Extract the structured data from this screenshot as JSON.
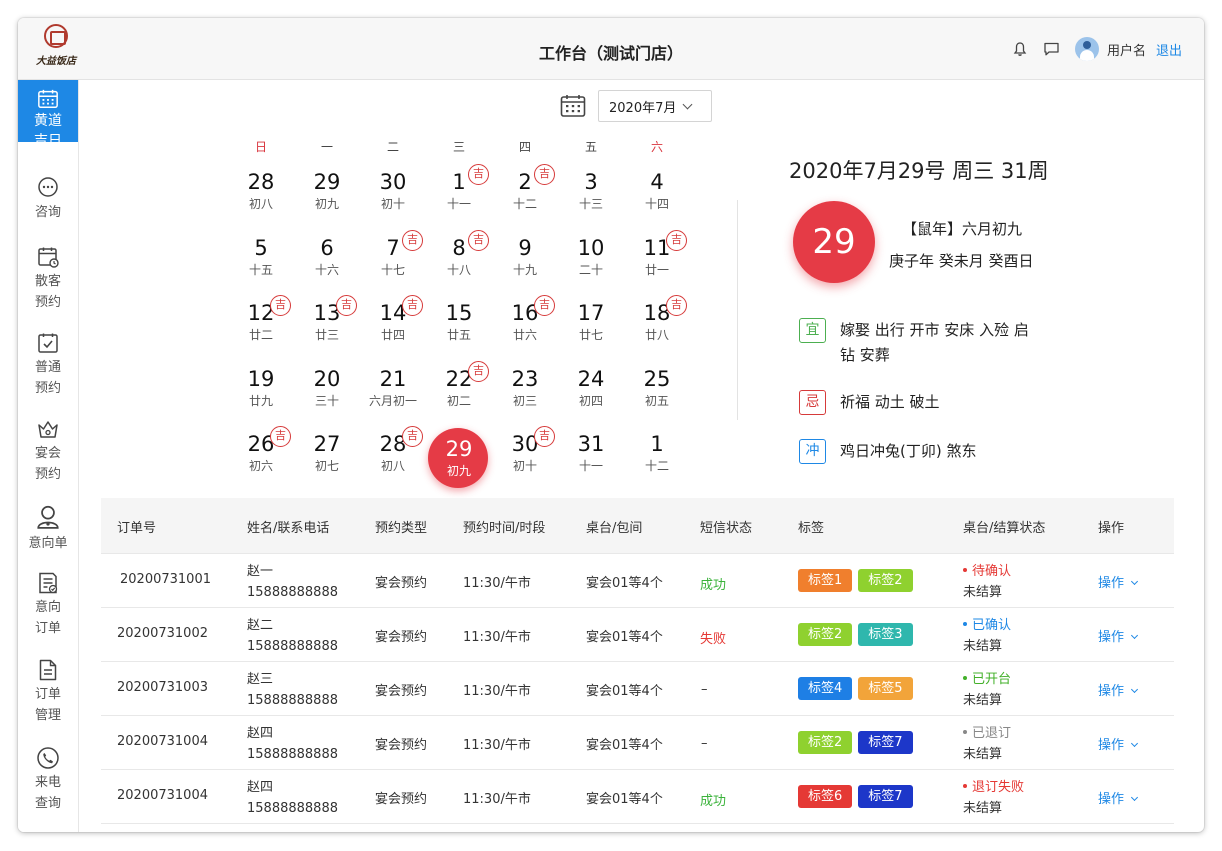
{
  "header": {
    "title": "工作台（测试门店）",
    "brand": "大益饭店",
    "username": "用户名",
    "logout": "退出",
    "icons": [
      "bell-icon",
      "message-icon",
      "avatar"
    ]
  },
  "sidebar": {
    "items": [
      {
        "label": "黄道吉日",
        "icon": "calendar-icon",
        "active": true
      },
      {
        "label": "咨询",
        "icon": "chat-bubble-icon"
      },
      {
        "label": "散客预约",
        "icon": "calendar-clock-icon"
      },
      {
        "label": "普通预约",
        "icon": "calendar-check-icon"
      },
      {
        "label": "宴会预约",
        "icon": "crown-basket-icon"
      },
      {
        "label": "意向单",
        "icon": "user-icon"
      },
      {
        "label": "意向订单",
        "icon": "document-check-icon"
      },
      {
        "label": "订单管理",
        "icon": "document-icon"
      },
      {
        "label": "来电查询",
        "icon": "phone-icon"
      }
    ]
  },
  "date_picker": {
    "value": "2020年7月"
  },
  "calendar": {
    "weekdays": [
      "日",
      "一",
      "二",
      "三",
      "四",
      "五",
      "六"
    ],
    "weekend_color": "#d9363e",
    "auspicious_mark": "吉",
    "selected_color": "#e53b46",
    "rows": [
      [
        {
          "d": "28",
          "l": "初八"
        },
        {
          "d": "29",
          "l": "初九"
        },
        {
          "d": "30",
          "l": "初十"
        },
        {
          "d": "1",
          "l": "十一",
          "ji": true
        },
        {
          "d": "2",
          "l": "十二",
          "ji": true
        },
        {
          "d": "3",
          "l": "十三"
        },
        {
          "d": "4",
          "l": "十四"
        }
      ],
      [
        {
          "d": "5",
          "l": "十五"
        },
        {
          "d": "6",
          "l": "十六"
        },
        {
          "d": "7",
          "l": "十七",
          "ji": true
        },
        {
          "d": "8",
          "l": "十八",
          "ji": true
        },
        {
          "d": "9",
          "l": "十九"
        },
        {
          "d": "10",
          "l": "二十"
        },
        {
          "d": "11",
          "l": "廿一",
          "ji": true
        }
      ],
      [
        {
          "d": "12",
          "l": "廿二",
          "ji": true
        },
        {
          "d": "13",
          "l": "廿三",
          "ji": true
        },
        {
          "d": "14",
          "l": "廿四",
          "ji": true
        },
        {
          "d": "15",
          "l": "廿五"
        },
        {
          "d": "16",
          "l": "廿六",
          "ji": true
        },
        {
          "d": "17",
          "l": "廿七"
        },
        {
          "d": "18",
          "l": "廿八",
          "ji": true
        }
      ],
      [
        {
          "d": "19",
          "l": "廿九"
        },
        {
          "d": "20",
          "l": "三十"
        },
        {
          "d": "21",
          "l": "六月初一"
        },
        {
          "d": "22",
          "l": "初二",
          "ji": true
        },
        {
          "d": "23",
          "l": "初三"
        },
        {
          "d": "24",
          "l": "初四"
        },
        {
          "d": "25",
          "l": "初五"
        }
      ],
      [
        {
          "d": "26",
          "l": "初六",
          "ji": true
        },
        {
          "d": "27",
          "l": "初七"
        },
        {
          "d": "28",
          "l": "初八",
          "ji": true
        },
        {
          "d": "29",
          "l": "初九",
          "selected": true
        },
        {
          "d": "30",
          "l": "初十",
          "ji": true
        },
        {
          "d": "31",
          "l": "十一"
        },
        {
          "d": "1",
          "l": "十二"
        }
      ]
    ]
  },
  "day_info": {
    "date_line": "2020年7月29号 周三 31周",
    "day_number": "29",
    "lunar_line1": "【鼠年】六月初九",
    "lunar_line2": "庚子年 癸未月 癸酉日",
    "yi_label": "宜",
    "yi_text": "嫁娶 出行 开市 安床 入殓 启钻 安葬",
    "yi_color": "#4caf50",
    "ji_label": "忌",
    "ji_text": "祈福 动土 破土",
    "ji_color": "#d63a3a",
    "chong_label": "冲",
    "chong_text": "鸡日冲兔(丁卯) 煞东",
    "chong_color": "#1e88e5"
  },
  "table": {
    "headers": [
      "订单号",
      "姓名/联系电话",
      "预约类型",
      "预约时间/时段",
      "桌台/包间",
      "短信状态",
      "标签",
      "桌台/结算状态",
      "操作"
    ],
    "rows": [
      {
        "order": "20200731001",
        "name": "赵一",
        "phone": "15888888888",
        "type": "宴会预约",
        "time": "11:30/午市",
        "table": "宴会01等4个",
        "sms": "成功",
        "sms_state": "ok",
        "tags": [
          {
            "text": "标签1",
            "color": "#f07f2d"
          },
          {
            "text": "标签2",
            "color": "#8fd12f"
          }
        ],
        "status": "待确认",
        "status_color": "#e53935",
        "settle": "未结算",
        "op": "操作"
      },
      {
        "order": "20200731002",
        "name": "赵二",
        "phone": "15888888888",
        "type": "宴会预约",
        "time": "11:30/午市",
        "table": "宴会01等4个",
        "sms": "失败",
        "sms_state": "fail",
        "tags": [
          {
            "text": "标签2",
            "color": "#8fd12f"
          },
          {
            "text": "标签3",
            "color": "#2fb7ad"
          }
        ],
        "status": "已确认",
        "status_color": "#1e88e5",
        "settle": "未结算",
        "op": "操作"
      },
      {
        "order": "20200731003",
        "name": "赵三",
        "phone": "15888888888",
        "type": "宴会预约",
        "time": "11:30/午市",
        "table": "宴会01等4个",
        "sms": "–",
        "sms_state": "none",
        "tags": [
          {
            "text": "标签4",
            "color": "#1e7fe5"
          },
          {
            "text": "标签5",
            "color": "#f2a43a"
          }
        ],
        "status": "已开台",
        "status_color": "#43b02a",
        "settle": "未结算",
        "op": "操作"
      },
      {
        "order": "20200731004",
        "name": "赵四",
        "phone": "15888888888",
        "type": "宴会预约",
        "time": "11:30/午市",
        "table": "宴会01等4个",
        "sms": "–",
        "sms_state": "none",
        "tags": [
          {
            "text": "标签2",
            "color": "#8fd12f"
          },
          {
            "text": "标签7",
            "color": "#1d37c9"
          }
        ],
        "status": "已退订",
        "status_color": "#888888",
        "settle": "未结算",
        "op": "操作"
      },
      {
        "order": "20200731004",
        "name": "赵四",
        "phone": "15888888888",
        "type": "宴会预约",
        "time": "11:30/午市",
        "table": "宴会01等4个",
        "sms": "成功",
        "sms_state": "ok",
        "tags": [
          {
            "text": "标签6",
            "color": "#e53935"
          },
          {
            "text": "标签7",
            "color": "#1d37c9"
          }
        ],
        "status": "退订失败",
        "status_color": "#e53935",
        "settle": "未结算",
        "op": "操作"
      }
    ]
  }
}
